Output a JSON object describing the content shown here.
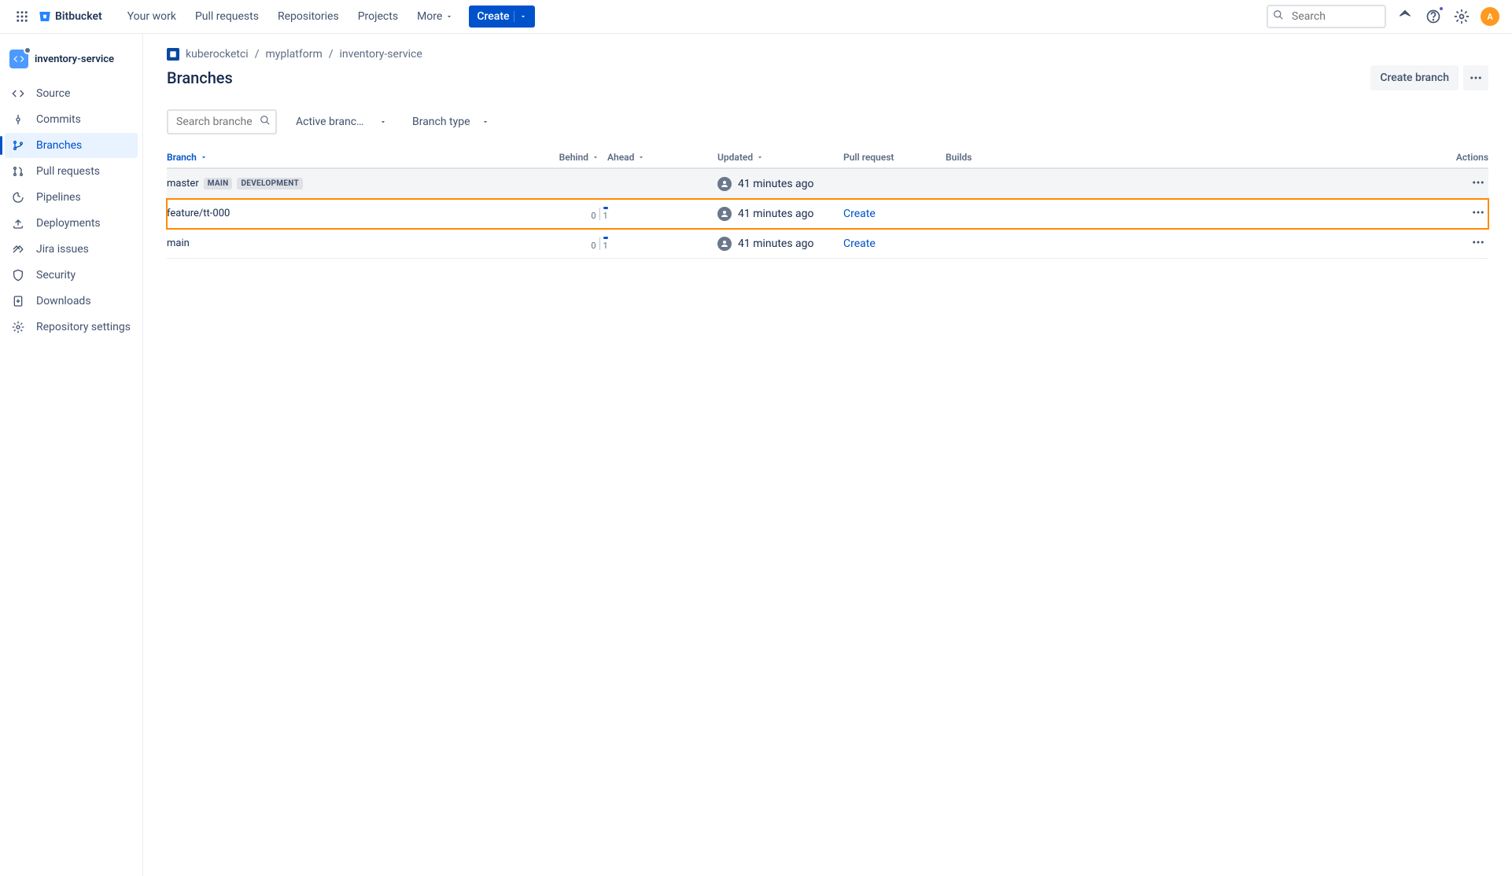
{
  "topnav": {
    "product": "Bitbucket",
    "items": [
      "Your work",
      "Pull requests",
      "Repositories",
      "Projects"
    ],
    "more": "More",
    "create": "Create",
    "searchPlaceholder": "Search",
    "avatar": "A"
  },
  "sidebar": {
    "repo": "inventory-service",
    "items": [
      {
        "label": "Source",
        "icon": "code"
      },
      {
        "label": "Commits",
        "icon": "commit"
      },
      {
        "label": "Branches",
        "icon": "branch",
        "active": true
      },
      {
        "label": "Pull requests",
        "icon": "pr"
      },
      {
        "label": "Pipelines",
        "icon": "pipeline"
      },
      {
        "label": "Deployments",
        "icon": "deploy"
      },
      {
        "label": "Jira issues",
        "icon": "jira"
      },
      {
        "label": "Security",
        "icon": "shield"
      },
      {
        "label": "Downloads",
        "icon": "download"
      },
      {
        "label": "Repository settings",
        "icon": "gear"
      }
    ]
  },
  "breadcrumb": {
    "workspace": "kuberocketci",
    "project": "myplatform",
    "repo": "inventory-service"
  },
  "page": {
    "title": "Branches",
    "createBranch": "Create branch"
  },
  "filters": {
    "searchPlaceholder": "Search branches",
    "activeBranches": "Active branches",
    "branchType": "Branch type"
  },
  "table": {
    "headers": {
      "branch": "Branch",
      "behind": "Behind",
      "ahead": "Ahead",
      "updated": "Updated",
      "pullRequest": "Pull request",
      "builds": "Builds",
      "actions": "Actions"
    },
    "rows": [
      {
        "name": "master",
        "tags": [
          "MAIN",
          "DEVELOPMENT"
        ],
        "behind": null,
        "ahead": null,
        "updated": "41 minutes ago",
        "pr": null,
        "highlight": false,
        "master": true
      },
      {
        "name": "feature/tt-000",
        "tags": [],
        "behind": 0,
        "ahead": 1,
        "updated": "41 minutes ago",
        "pr": "Create",
        "highlight": true,
        "master": false
      },
      {
        "name": "main",
        "tags": [],
        "behind": 0,
        "ahead": 1,
        "updated": "41 minutes ago",
        "pr": "Create",
        "highlight": false,
        "master": false
      }
    ]
  }
}
